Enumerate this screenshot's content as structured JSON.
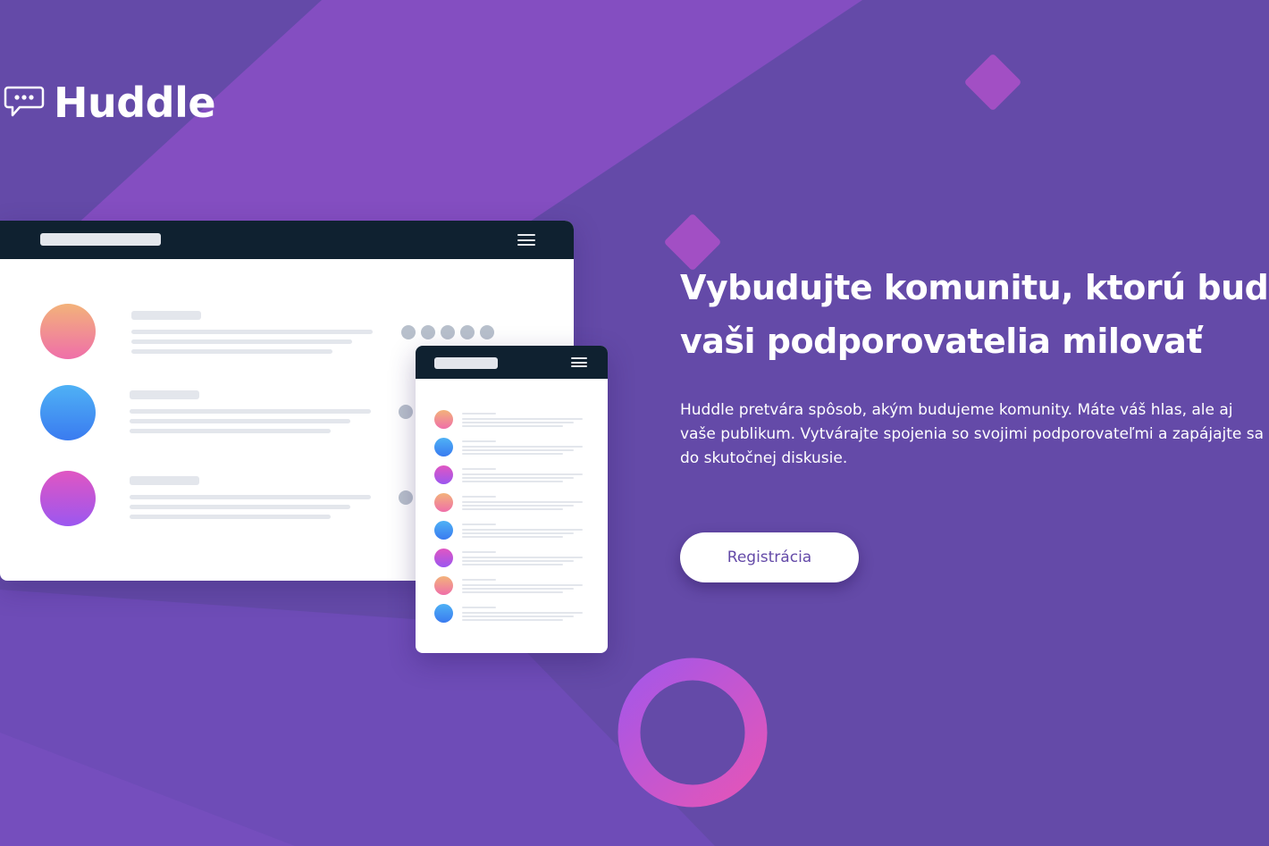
{
  "logo": {
    "text": "Huddle",
    "icon": "chat-bubble-icon"
  },
  "hero": {
    "title_line1": "Vybudujte komunitu, ktorú budú",
    "title_line2": "vaši podporovatelia milovať",
    "description": "Huddle pretvára spôsob, akým budujeme komunity. Máte váš hlas, ale aj vaše publikum. Vytvárajte spojenia so svojimi podporovateľmi a zapájajte sa do skutočnej diskusie.",
    "cta_label": "Registrácia"
  },
  "mockup": {
    "menu_icon": "hamburger-menu-icon",
    "desktop_rows": [
      "orange",
      "blue",
      "purple"
    ],
    "mobile_rows": [
      "orange",
      "blue",
      "purple",
      "orange",
      "blue",
      "purple",
      "orange",
      "blue"
    ]
  },
  "colors": {
    "background": "#644aa8",
    "accent_pink": "#e352b8",
    "mockup_bar": "#0f2130",
    "avatar_orange": "#f3b27a",
    "avatar_blue": "#4fb1f5",
    "avatar_purple": "#c15fd9"
  }
}
